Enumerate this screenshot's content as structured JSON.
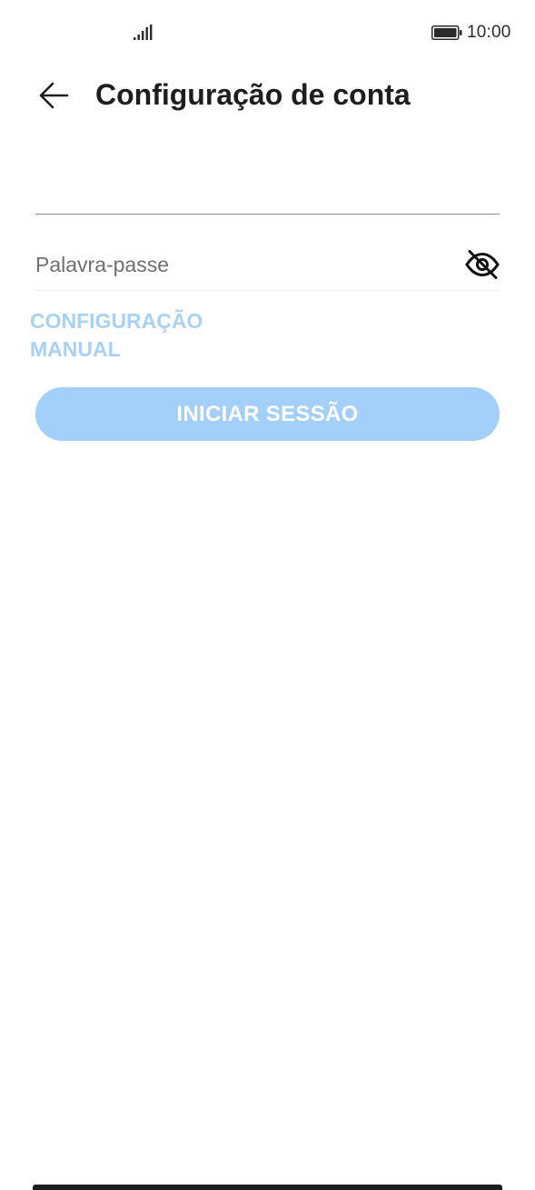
{
  "status_bar": {
    "time": "10:00",
    "signal_icon": "signal-bars-icon",
    "battery_icon": "battery-icon"
  },
  "header": {
    "back_icon": "arrow-left-icon",
    "title": "Configuração de conta"
  },
  "form": {
    "email": {
      "value": "",
      "placeholder": ""
    },
    "password": {
      "value": "",
      "placeholder": "Palavra-passe",
      "visibility_icon": "eye-off-icon"
    },
    "manual_config_label": "CONFIGURAÇÃO MANUAL",
    "login_button_label": "INICIAR SESSÃO"
  },
  "colors": {
    "accent_disabled": "#a3d0fa",
    "link_disabled": "#a7d2f6",
    "text_primary": "#1e1e1e"
  }
}
